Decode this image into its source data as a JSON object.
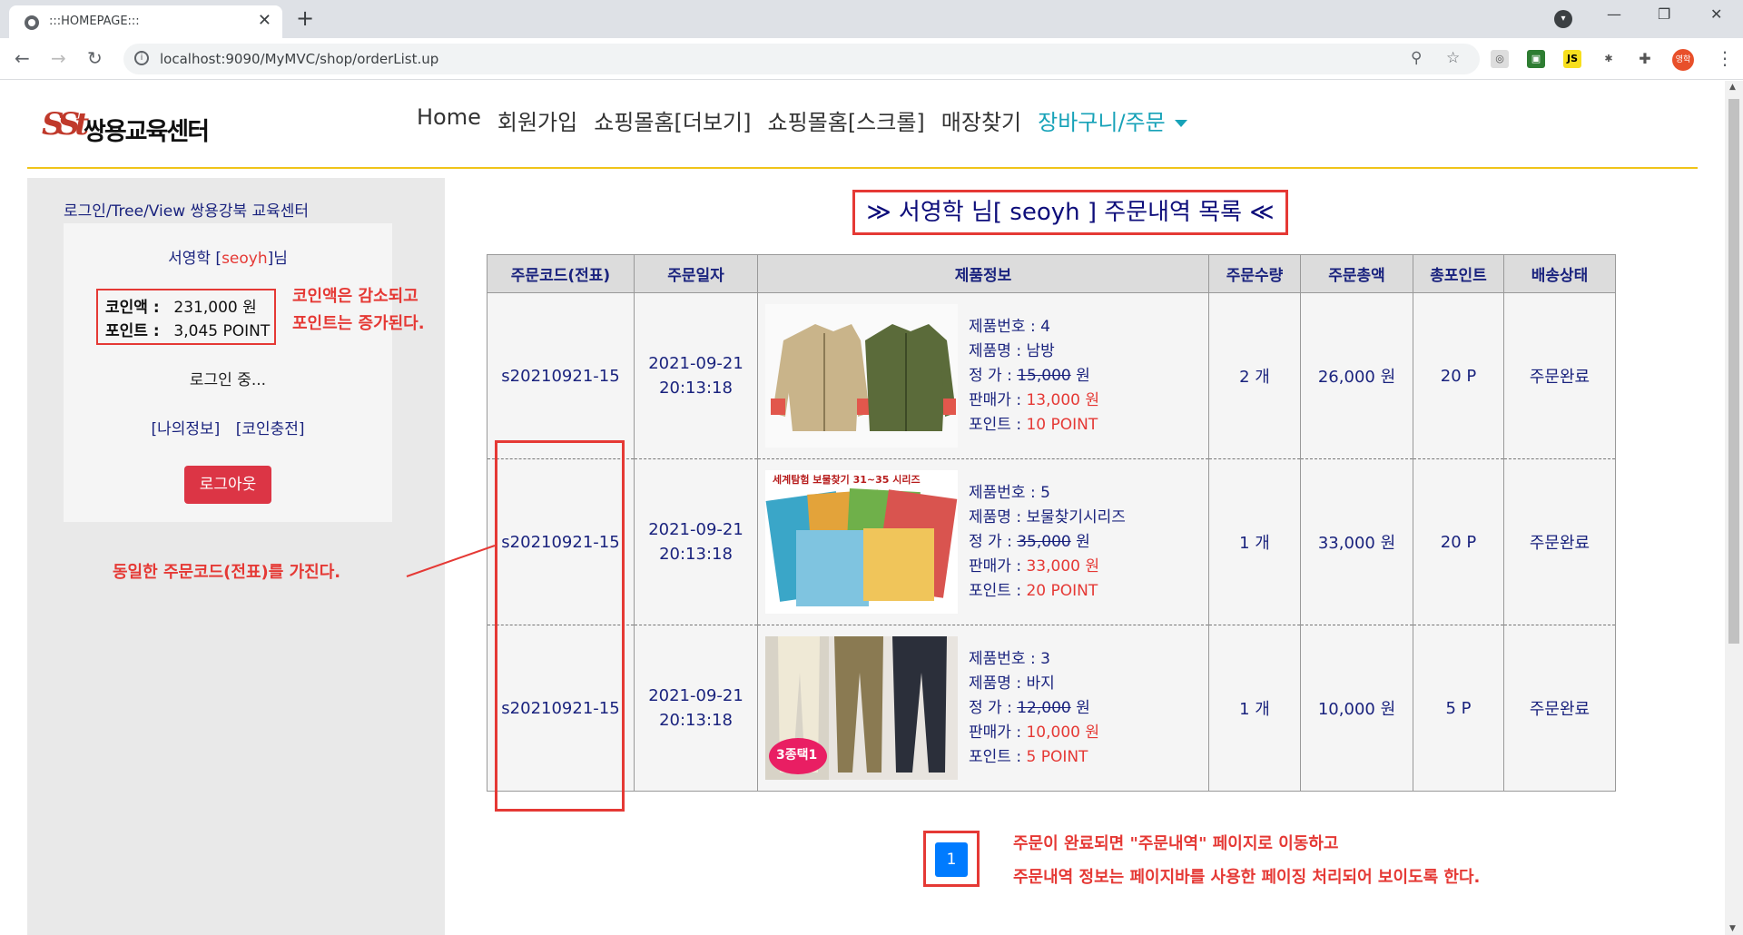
{
  "browser": {
    "tab_title": ":::HOMEPAGE:::",
    "url": "localhost:9090/MyMVC/shop/orderList.up",
    "profile_label": "영학",
    "ext_js": "JS"
  },
  "header": {
    "logo_text": "쌍용교육센터",
    "logo_mark": "SSt",
    "menu": [
      "Home",
      "회원가입",
      "쇼핑몰홈[더보기]",
      "쇼핑몰홈[스크롤]",
      "매장찾기",
      "장바구니/주문"
    ]
  },
  "sidebar": {
    "crumb": "로그인/Tree/View  쌍용강북 교육센터",
    "user_name": "서영학",
    "user_id": "seoyh",
    "user_suffix": "님",
    "coin_label": "코인액 :",
    "coin_value": "231,000 원",
    "point_label": "포인트 :",
    "point_value": "3,045 POINT",
    "status": "로그인 중...",
    "link_myinfo": "[나의정보]",
    "link_charge": "[코인충전]",
    "logout": "로그아웃"
  },
  "annotations": {
    "coin_line1": "코인액은 감소되고",
    "coin_line2": "포인트는 증가된다.",
    "same_code": "동일한 주문코드(전표)를 가진다.",
    "page_line1": "주문이 완료되면 \"주문내역\" 페이지로 이동하고",
    "page_line2": "주문내역 정보는 페이지바를 사용한 페이징 처리되어 보이도록 한다."
  },
  "main": {
    "title": "≫  서영학 님[ seoyh ] 주문내역 목록  ≪",
    "columns": [
      "주문코드(전표)",
      "주문일자",
      "제품정보",
      "주문수량",
      "주문총액",
      "총포인트",
      "배송상태"
    ],
    "rows": [
      {
        "code": "s20210921-15",
        "date": "2021-09-21",
        "time": "20:13:18",
        "no": "제품번호 : 4",
        "name": "제품명 : 남방",
        "price_label": "정 가 : ",
        "price": "15,000",
        "price_unit": " 원",
        "sale_label": "판매가 : ",
        "sale": "13,000 원",
        "point_label": "포인트 : ",
        "point": "10 POINT",
        "qty": "2 개",
        "total": "26,000 원",
        "total_point": "20 P",
        "status": "주문완료",
        "img": "jacket-image"
      },
      {
        "code": "s20210921-15",
        "date": "2021-09-21",
        "time": "20:13:18",
        "no": "제품번호 : 5",
        "name": "제품명 : 보물찾기시리즈",
        "price_label": "정 가 : ",
        "price": "35,000",
        "price_unit": " 원",
        "sale_label": "판매가 : ",
        "sale": "33,000 원",
        "point_label": "포인트 : ",
        "point": "20 POINT",
        "qty": "1 개",
        "total": "33,000 원",
        "total_point": "20 P",
        "status": "주문완료",
        "img": "books-image",
        "img_caption": "세계탐험 보물찾기 31~35 시리즈"
      },
      {
        "code": "s20210921-15",
        "date": "2021-09-21",
        "time": "20:13:18",
        "no": "제품번호 : 3",
        "name": "제품명 : 바지",
        "price_label": "정 가 : ",
        "price": "12,000",
        "price_unit": " 원",
        "sale_label": "판매가 : ",
        "sale": "10,000 원",
        "point_label": "포인트 : ",
        "point": "5 POINT",
        "qty": "1 개",
        "total": "10,000 원",
        "total_point": "5 P",
        "status": "주문완료",
        "img": "pants-image",
        "img_caption": "3종택1"
      }
    ],
    "pager": "1"
  },
  "colors": {
    "accent": "#17a2b8",
    "highlight": "#e53935",
    "navy": "#1a237e",
    "pager": "#007bff",
    "logout": "#dc3545"
  }
}
